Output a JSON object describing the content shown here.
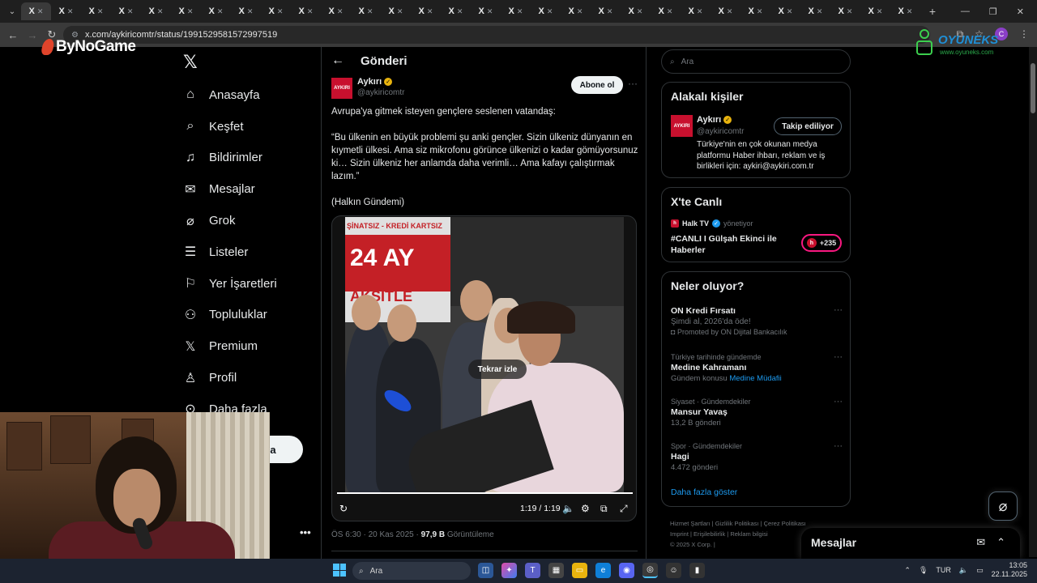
{
  "browser": {
    "tab_label": "X",
    "tab_count": 30,
    "url": "x.com/aykiricomtr/status/1991529581572997519",
    "colors": {
      "chrome_bg": "#1f1f1f",
      "toolbar_bg": "#3a3a3a"
    }
  },
  "overlays": {
    "left_logo": "ByNoGame",
    "right_logo": "OYUNEKS",
    "right_logo_sub": "www.oyuneks.com"
  },
  "nav": {
    "items": [
      {
        "label": "Anasayfa",
        "icon": "home-icon"
      },
      {
        "label": "Keşfet",
        "icon": "search-icon"
      },
      {
        "label": "Bildirimler",
        "icon": "bell-icon"
      },
      {
        "label": "Mesajlar",
        "icon": "mail-icon"
      },
      {
        "label": "Grok",
        "icon": "grok-icon"
      },
      {
        "label": "Listeler",
        "icon": "list-icon"
      },
      {
        "label": "Yer İşaretleri",
        "icon": "bookmark-icon"
      },
      {
        "label": "Topluluklar",
        "icon": "people-icon"
      },
      {
        "label": "Premium",
        "icon": "x-logo-icon"
      },
      {
        "label": "Profil",
        "icon": "person-icon"
      },
      {
        "label": "Daha fazla",
        "icon": "more-circle-icon"
      }
    ],
    "post_button_visible_text": "a",
    "more": "•••"
  },
  "post": {
    "page_title": "Gönderi",
    "author_name": "Aykırı",
    "author_handle": "@aykiricomtr",
    "avatar_text": "AYKIRI",
    "follow_label": "Abone ol",
    "more": "···",
    "text": [
      "Avrupa'ya gitmek isteyen gençlere seslenen vatandaş:",
      "“Bu ülkenin en büyük problemi şu anki gençler. Sizin ülkeniz dünyanın en kıymetli ülkesi. Ama siz mikrofonu görünce ülkenizi o kadar gömüyorsunuz ki… Sizin ülkeniz her anlamda daha verimli… Ama kafayı çalıştırmak lazım.”",
      "(Halkın Gündemi)"
    ],
    "video": {
      "replay_label": "Tekrar izle",
      "timecode": "1:19 / 1:19",
      "progress": 1.0,
      "sign_top": "ŞİNATSIZ - KREDİ KARTSIZ",
      "sign_big": "24 AY",
      "sign_bottom": "AKSİTLE"
    },
    "meta": {
      "time": "ÖS 6:30 · 20 Kas 2025 · ",
      "views": "97,9 B",
      "views_label": " Görüntüleme"
    }
  },
  "sidebar": {
    "search_placeholder": "Ara",
    "related": {
      "title": "Alakalı kişiler",
      "name": "Aykırı",
      "handle": "@aykiricomtr",
      "avatar_text": "AYKIRI",
      "button": "Takip ediliyor",
      "bio": "Türkiye'nin en çok okunan medya platformu Haber ihbarı, reklam ve iş birlikleri için: aykiri@aykiri.com.tr"
    },
    "live": {
      "title": "X'te Canlı",
      "host": "Halk TV",
      "host_suffix": "yönetiyor",
      "host_logo": "h",
      "stream_title": "#CANLI I Gülşah Ekinci ile Haberler",
      "count": "+235"
    },
    "trends": {
      "title": "Neler oluyor?",
      "items": [
        {
          "context": "",
          "name": "ON Kredi Fırsatı",
          "sub": "Şimdi al, 2026'da öde!",
          "sub2": "Promoted by ON Dijital Bankacılık"
        },
        {
          "context": "Türkiye tarihinde gündemde",
          "name": "Medine Kahramanı",
          "sub": "Gündem konusu ",
          "link": "Medine Müdafii"
        },
        {
          "context": "Siyaset · Gündemdekiler",
          "name": "Mansur Yavaş",
          "sub": "13,2 B gönderi"
        },
        {
          "context": "Spor · Gündemdekiler",
          "name": "Hagi",
          "sub": "4.472 gönderi"
        }
      ],
      "show_more": "Daha fazla göster"
    },
    "footer": [
      "Hizmet Şartları",
      "Gizlilik Politikası",
      "Çerez Politikası",
      "Imprint",
      "Erişilebilirlik",
      "Reklam bilgisi",
      "© 2025 X Corp."
    ]
  },
  "messages_drawer": {
    "title": "Mesajlar"
  },
  "taskbar": {
    "search_placeholder": "Ara",
    "lang": "TUR",
    "time": "13:05",
    "date": "22.11.2025"
  }
}
